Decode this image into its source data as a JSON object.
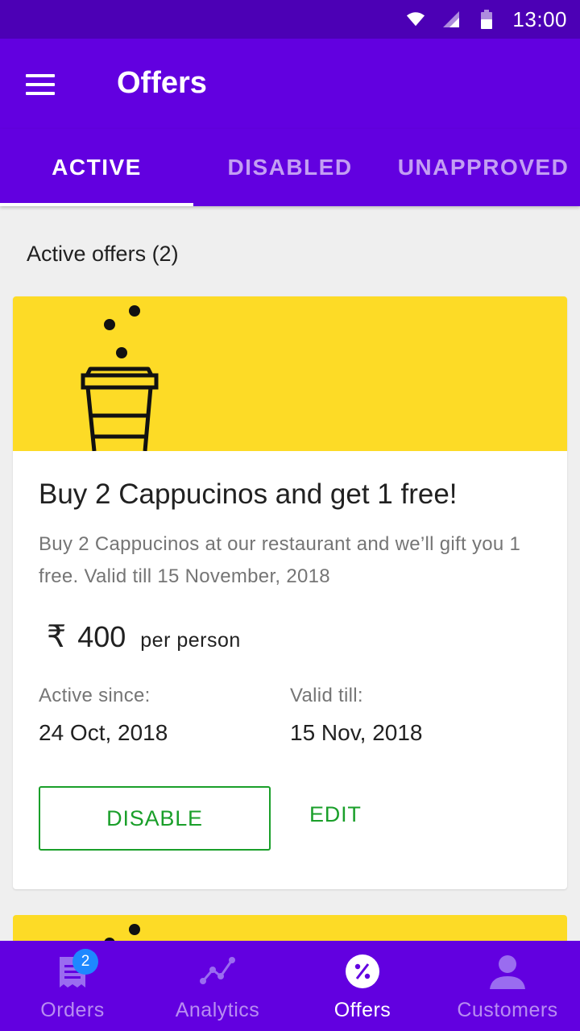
{
  "status_bar": {
    "time": "13:00",
    "icons": [
      "wifi-icon",
      "signal-icon",
      "battery-icon"
    ]
  },
  "app_bar": {
    "title": "Offers",
    "menu_icon": "menu-icon"
  },
  "tabs": [
    {
      "label": "ACTIVE",
      "active": true
    },
    {
      "label": "DISABLED",
      "active": false
    },
    {
      "label": "UNAPPROVED",
      "active": false
    }
  ],
  "section": {
    "title": "Active offers (2)"
  },
  "offer": {
    "banner_color": "#fddb26",
    "banner_icon": "coffee-cup-icon",
    "title": "Buy 2 Cappucinos and get 1 free!",
    "description": "Buy 2 Cappucinos at our restaurant and we’ll gift you 1 free. Valid till 15 November, 2018",
    "currency_symbol": "₹",
    "price": "400",
    "price_unit": "per person",
    "active_since_label": "Active since:",
    "active_since_value": "24 Oct, 2018",
    "valid_till_label": "Valid till:",
    "valid_till_value": "15 Nov, 2018",
    "disable_label": "DISABLE",
    "edit_label": "EDIT",
    "action_color": "#1a9f2a"
  },
  "bottom_nav": [
    {
      "label": "Orders",
      "icon": "receipt-icon",
      "badge": "2",
      "active": false
    },
    {
      "label": "Analytics",
      "icon": "analytics-icon",
      "active": false
    },
    {
      "label": "Offers",
      "icon": "percent-badge-icon",
      "active": true
    },
    {
      "label": "Customers",
      "icon": "person-icon",
      "active": false
    }
  ],
  "colors": {
    "primary": "#6200e0",
    "primary_dark": "#4c00b5",
    "background": "#efefef"
  }
}
